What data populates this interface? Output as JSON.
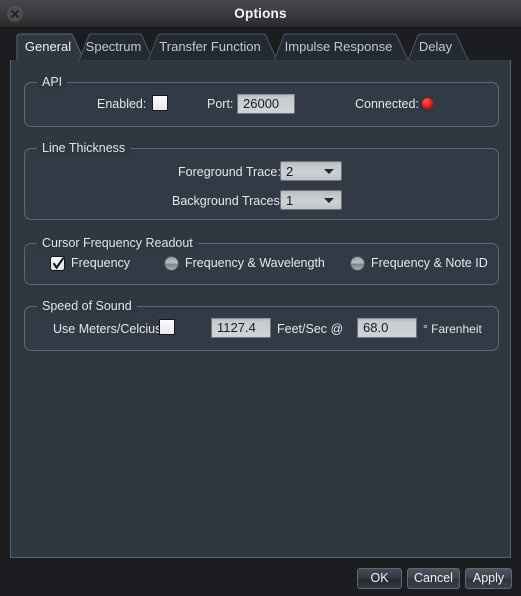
{
  "window": {
    "title": "Options",
    "close_icon": "close-icon"
  },
  "tabs": [
    {
      "label": "General",
      "active": true
    },
    {
      "label": "Spectrum",
      "active": false
    },
    {
      "label": "Transfer Function",
      "active": false
    },
    {
      "label": "Impulse Response",
      "active": false
    },
    {
      "label": "Delay",
      "active": false
    }
  ],
  "groups": {
    "api": {
      "title": "API",
      "enabled_label": "Enabled:",
      "enabled_checked": false,
      "port_label": "Port:",
      "port_value": "26000",
      "connected_label": "Connected:",
      "connected_color": "#f31408"
    },
    "line_thickness": {
      "title": "Line Thickness",
      "foreground_label": "Foreground Trace:",
      "foreground_value": "2",
      "background_label": "Background Traces:",
      "background_value": "1"
    },
    "cursor_readout": {
      "title": "Cursor Frequency Readout",
      "options": [
        {
          "label": "Frequency",
          "selected": true
        },
        {
          "label": "Frequency & Wavelength",
          "selected": false
        },
        {
          "label": "Frequency & Note ID",
          "selected": false
        }
      ]
    },
    "speed_of_sound": {
      "title": "Speed of Sound",
      "units_label": "Use Meters/Celcius:",
      "units_checked": false,
      "speed_value": "1127.4",
      "speed_unit_label": "Feet/Sec @",
      "temp_value": "68.0",
      "temp_unit_label": "° Farenheit"
    }
  },
  "footer": {
    "ok_label": "OK",
    "cancel_label": "Cancel",
    "apply_label": "Apply"
  }
}
